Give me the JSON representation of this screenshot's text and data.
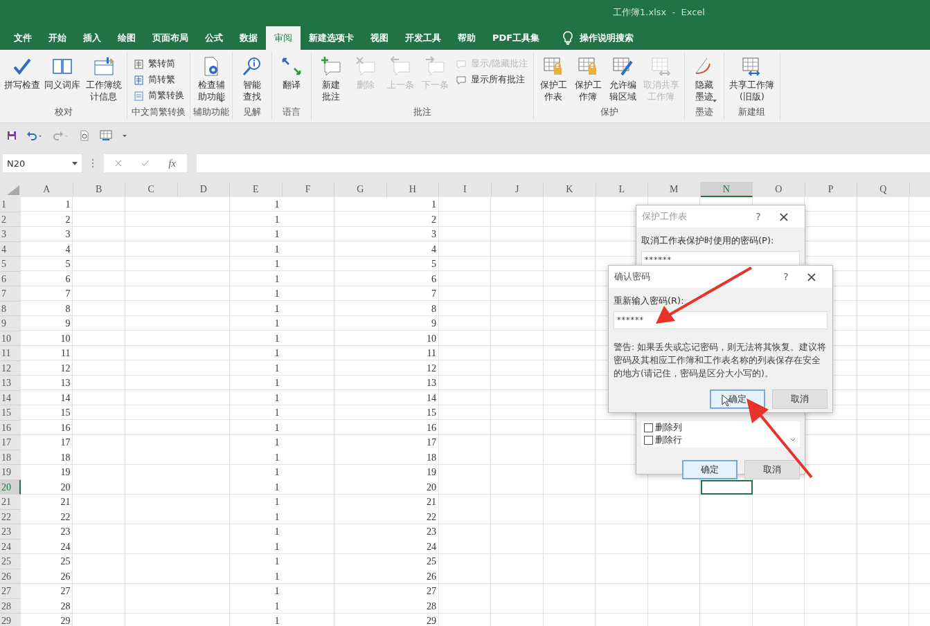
{
  "window": {
    "title": "工作簿1.xlsx  -  Excel"
  },
  "tabs": [
    {
      "label": "文件",
      "selected": false
    },
    {
      "label": "开始",
      "selected": false
    },
    {
      "label": "插入",
      "selected": false
    },
    {
      "label": "绘图",
      "selected": false
    },
    {
      "label": "页面布局",
      "selected": false
    },
    {
      "label": "公式",
      "selected": false
    },
    {
      "label": "数据",
      "selected": false
    },
    {
      "label": "审阅",
      "selected": true
    },
    {
      "label": "新建选项卡",
      "selected": false
    },
    {
      "label": "视图",
      "selected": false
    },
    {
      "label": "开发工具",
      "selected": false
    },
    {
      "label": "帮助",
      "selected": false
    },
    {
      "label": "PDF工具集",
      "selected": false
    }
  ],
  "tell_me": {
    "label": "操作说明搜索"
  },
  "ribbon_groups": [
    {
      "label": "校对",
      "buttons": [
        {
          "kind": "large",
          "label": "拼写检查",
          "disabled": false,
          "dropdown": false
        },
        {
          "kind": "large",
          "label": "同义词库",
          "disabled": false,
          "dropdown": false
        },
        {
          "kind": "large",
          "label": "工作簿统计信息",
          "disabled": false,
          "dropdown": false
        }
      ]
    },
    {
      "label": "中文简繁转换",
      "buttons": [
        {
          "kind": "small",
          "label": "繁转简",
          "disabled": false,
          "dropdown": false
        },
        {
          "kind": "small",
          "label": "简转繁",
          "disabled": false,
          "dropdown": false
        },
        {
          "kind": "small",
          "label": "简繁转换",
          "disabled": false,
          "dropdown": false
        }
      ]
    },
    {
      "label": "辅助功能",
      "buttons": [
        {
          "kind": "large",
          "label": "检查辅助功能",
          "disabled": false,
          "dropdown": true
        }
      ]
    },
    {
      "label": "见解",
      "buttons": [
        {
          "kind": "large",
          "label": "智能查找",
          "disabled": false,
          "dropdown": false
        }
      ]
    },
    {
      "label": "语言",
      "buttons": [
        {
          "kind": "large",
          "label": "翻译",
          "disabled": false,
          "dropdown": false
        }
      ]
    },
    {
      "label": "批注",
      "buttons": [
        {
          "kind": "large",
          "label": "新建批注",
          "disabled": false,
          "dropdown": false
        },
        {
          "kind": "large",
          "label": "删除",
          "disabled": true,
          "dropdown": false
        },
        {
          "kind": "large",
          "label": "上一条",
          "disabled": true,
          "dropdown": false
        },
        {
          "kind": "large",
          "label": "下一条",
          "disabled": true,
          "dropdown": false
        },
        {
          "kind": "small",
          "label": "显示/隐藏批注",
          "disabled": true,
          "dropdown": false
        },
        {
          "kind": "small",
          "label": "显示所有批注",
          "disabled": false,
          "dropdown": false
        }
      ]
    },
    {
      "label": "保护",
      "buttons": [
        {
          "kind": "large",
          "label": "保护工作表",
          "disabled": false,
          "dropdown": false
        },
        {
          "kind": "large",
          "label": "保护工作簿",
          "disabled": false,
          "dropdown": false
        },
        {
          "kind": "large",
          "label": "允许编辑区域",
          "disabled": false,
          "dropdown": false
        },
        {
          "kind": "large",
          "label": "取消共享工作簿",
          "disabled": true,
          "dropdown": false
        }
      ]
    },
    {
      "label": "墨迹",
      "buttons": [
        {
          "kind": "large",
          "label": "隐藏墨迹",
          "disabled": false,
          "dropdown": true
        }
      ]
    },
    {
      "label": "新建组",
      "buttons": [
        {
          "kind": "large",
          "label": "共享工作簿(旧版)",
          "disabled": false,
          "dropdown": false
        }
      ]
    }
  ],
  "formula_bar": {
    "name_box": "N20",
    "function_label": "fx"
  },
  "sheet": {
    "columns": [
      {
        "label": "A",
        "selected": false
      },
      {
        "label": "B",
        "selected": false
      },
      {
        "label": "C",
        "selected": false
      },
      {
        "label": "D",
        "selected": false
      },
      {
        "label": "E",
        "selected": false
      },
      {
        "label": "F",
        "selected": false
      },
      {
        "label": "G",
        "selected": false
      },
      {
        "label": "H",
        "selected": false
      },
      {
        "label": "I",
        "selected": false
      },
      {
        "label": "J",
        "selected": false
      },
      {
        "label": "K",
        "selected": false
      },
      {
        "label": "L",
        "selected": false
      },
      {
        "label": "M",
        "selected": false
      },
      {
        "label": "N",
        "selected": true
      },
      {
        "label": "O",
        "selected": false
      },
      {
        "label": "P",
        "selected": false
      },
      {
        "label": "Q",
        "selected": false
      }
    ],
    "rows": [
      {
        "number": "1",
        "selected": false,
        "column_a": "1",
        "column_e": "1",
        "column_h": "1"
      },
      {
        "number": "2",
        "selected": false,
        "column_a": "2",
        "column_e": "1",
        "column_h": "2"
      },
      {
        "number": "3",
        "selected": false,
        "column_a": "3",
        "column_e": "1",
        "column_h": "3"
      },
      {
        "number": "4",
        "selected": false,
        "column_a": "4",
        "column_e": "1",
        "column_h": "4"
      },
      {
        "number": "5",
        "selected": false,
        "column_a": "5",
        "column_e": "1",
        "column_h": "5"
      },
      {
        "number": "6",
        "selected": false,
        "column_a": "6",
        "column_e": "1",
        "column_h": "6"
      },
      {
        "number": "7",
        "selected": false,
        "column_a": "7",
        "column_e": "1",
        "column_h": "7"
      },
      {
        "number": "8",
        "selected": false,
        "column_a": "8",
        "column_e": "1",
        "column_h": "8"
      },
      {
        "number": "9",
        "selected": false,
        "column_a": "9",
        "column_e": "1",
        "column_h": "9"
      },
      {
        "number": "10",
        "selected": false,
        "column_a": "10",
        "column_e": "1",
        "column_h": "10"
      },
      {
        "number": "11",
        "selected": false,
        "column_a": "11",
        "column_e": "1",
        "column_h": "11"
      },
      {
        "number": "12",
        "selected": false,
        "column_a": "12",
        "column_e": "1",
        "column_h": "12"
      },
      {
        "number": "13",
        "selected": false,
        "column_a": "13",
        "column_e": "1",
        "column_h": "13"
      },
      {
        "number": "14",
        "selected": false,
        "column_a": "14",
        "column_e": "1",
        "column_h": "14"
      },
      {
        "number": "15",
        "selected": false,
        "column_a": "15",
        "column_e": "1",
        "column_h": "15"
      },
      {
        "number": "16",
        "selected": false,
        "column_a": "16",
        "column_e": "1",
        "column_h": "16"
      },
      {
        "number": "17",
        "selected": false,
        "column_a": "17",
        "column_e": "1",
        "column_h": "17"
      },
      {
        "number": "18",
        "selected": false,
        "column_a": "18",
        "column_e": "1",
        "column_h": "18"
      },
      {
        "number": "19",
        "selected": false,
        "column_a": "19",
        "column_e": "1",
        "column_h": "19"
      },
      {
        "number": "20",
        "selected": true,
        "column_a": "20",
        "column_e": "1",
        "column_h": "20"
      },
      {
        "number": "21",
        "selected": false,
        "column_a": "21",
        "column_e": "1",
        "column_h": "21"
      },
      {
        "number": "22",
        "selected": false,
        "column_a": "22",
        "column_e": "1",
        "column_h": "22"
      },
      {
        "number": "23",
        "selected": false,
        "column_a": "23",
        "column_e": "1",
        "column_h": "23"
      },
      {
        "number": "24",
        "selected": false,
        "column_a": "24",
        "column_e": "1",
        "column_h": "24"
      },
      {
        "number": "25",
        "selected": false,
        "column_a": "25",
        "column_e": "1",
        "column_h": "25"
      },
      {
        "number": "26",
        "selected": false,
        "column_a": "26",
        "column_e": "1",
        "column_h": "26"
      },
      {
        "number": "27",
        "selected": false,
        "column_a": "27",
        "column_e": "1",
        "column_h": "27"
      },
      {
        "number": "28",
        "selected": false,
        "column_a": "28",
        "column_e": "1",
        "column_h": "28"
      },
      {
        "number": "29",
        "selected": false,
        "column_a": "29",
        "column_e": "1",
        "column_h": "29"
      }
    ]
  },
  "protect_sheet_dialog": {
    "title": "保护工作表",
    "help": "?",
    "close": "×",
    "password_label": "取消工作表保护时使用的密码(P):",
    "password_value": "******",
    "permissions": [
      {
        "label": "删除列",
        "checked": false
      },
      {
        "label": "删除行",
        "checked": false
      }
    ],
    "ok": "确定",
    "cancel": "取消"
  },
  "confirm_dialog": {
    "title": "确认密码",
    "help": "?",
    "close": "×",
    "label": "重新输入密码(R):",
    "value": "******",
    "warning": "警告: 如果丢失或忘记密码，则无法将其恢复。建议将密码及其相应工作簿和工作表名称的列表保存在安全的地方(请记住，密码是区分大小写的)。",
    "ok": "确定",
    "cancel": "取消"
  }
}
